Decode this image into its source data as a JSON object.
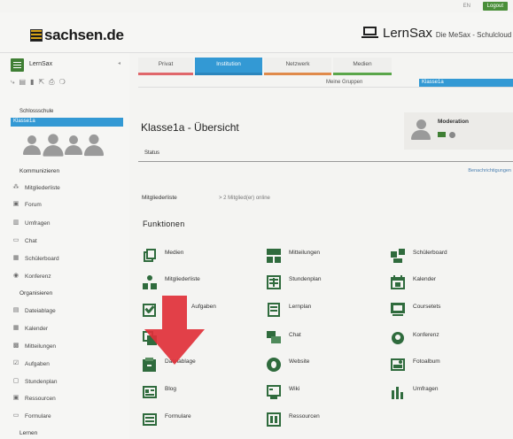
{
  "topbar": {
    "lang": "EN",
    "logout_label": "Logout"
  },
  "header": {
    "brand": "sachsen.de",
    "product": "LernSax",
    "tagline": "Die MeSax - Schulcloud"
  },
  "rail": {
    "title": "LernSax",
    "school": "Schlossschule",
    "selected_group": "Klasse1a",
    "section_kommunizieren": "Kommunizieren",
    "section_organisieren": "Organisieren",
    "section_lernen": "Lernen",
    "kommunizieren_items": [
      {
        "label": "Mitgliederliste",
        "icon": "members-icon"
      },
      {
        "label": "Forum",
        "icon": "forum-icon"
      },
      {
        "label": "Umfragen",
        "icon": "poll-icon"
      },
      {
        "label": "Chat",
        "icon": "chat-icon"
      },
      {
        "label": "Schülerboard",
        "icon": "board-icon"
      },
      {
        "label": "Konferenz",
        "icon": "conference-icon"
      }
    ],
    "organisieren_items": [
      {
        "label": "Dateiablage",
        "icon": "folder-icon"
      },
      {
        "label": "Kalender",
        "icon": "calendar-icon"
      },
      {
        "label": "Mitteilungen",
        "icon": "notice-icon"
      },
      {
        "label": "Aufgaben",
        "icon": "tasks-icon"
      },
      {
        "label": "Stundenplan",
        "icon": "timetable-icon"
      },
      {
        "label": "Ressourcen",
        "icon": "resources-icon"
      },
      {
        "label": "Formulare",
        "icon": "forms-icon"
      }
    ]
  },
  "nav": {
    "tabs": [
      {
        "label": "Privat",
        "bar": "#e0676b"
      },
      {
        "label": "Institution",
        "bar": "#3399d4"
      },
      {
        "label": "Netzwerk",
        "bar": "#e08a4a"
      },
      {
        "label": "Medien",
        "bar": "#5aa64a"
      }
    ],
    "meine_gruppen": "Meine Gruppen",
    "group_select": "Klasse1a"
  },
  "main": {
    "title": "Klasse1a - Übersicht",
    "moderation": "Moderation",
    "status": "Status",
    "benachrichtigungen": "Benachrichtigungen",
    "mitgliederliste_label": "Mitgliederliste",
    "online_text": "> 2 Mitglied(er) online",
    "funktionen_title": "Funktionen"
  },
  "functions": [
    {
      "label": "Medien",
      "icon": "media-icon"
    },
    {
      "label": "Mitteilungen",
      "icon": "notice-icon"
    },
    {
      "label": "Schülerboard",
      "icon": "board-icon"
    },
    {
      "label": "Mitgliederliste",
      "icon": "members-icon"
    },
    {
      "label": "Stundenplan",
      "icon": "timetable-icon"
    },
    {
      "label": "Kalender",
      "icon": "calendar-icon"
    },
    {
      "label": "Aufgaben",
      "icon": "tasks-icon"
    },
    {
      "label": "Lernplan",
      "icon": "learnplan-icon"
    },
    {
      "label": "Coursetets",
      "icon": "coursetest-icon"
    },
    {
      "label": "",
      "icon": "forum-icon"
    },
    {
      "label": "Chat",
      "icon": "chat-icon"
    },
    {
      "label": "Konferenz",
      "icon": "conference-icon"
    },
    {
      "label": "Dateiablage",
      "icon": "folder-icon"
    },
    {
      "label": "Website",
      "icon": "website-icon"
    },
    {
      "label": "Fotoalbum",
      "icon": "photo-icon"
    },
    {
      "label": "Blog",
      "icon": "blog-icon"
    },
    {
      "label": "Wiki",
      "icon": "wiki-icon"
    },
    {
      "label": "Umfragen",
      "icon": "poll-icon"
    },
    {
      "label": "Formulare",
      "icon": "forms-icon"
    },
    {
      "label": "Ressourcen",
      "icon": "resources-icon"
    }
  ],
  "colors": {
    "accent": "#3399d4",
    "icon_green": "#2f6b3d",
    "arrow_red": "#e0303a",
    "logout_green": "#4a8f3a"
  }
}
